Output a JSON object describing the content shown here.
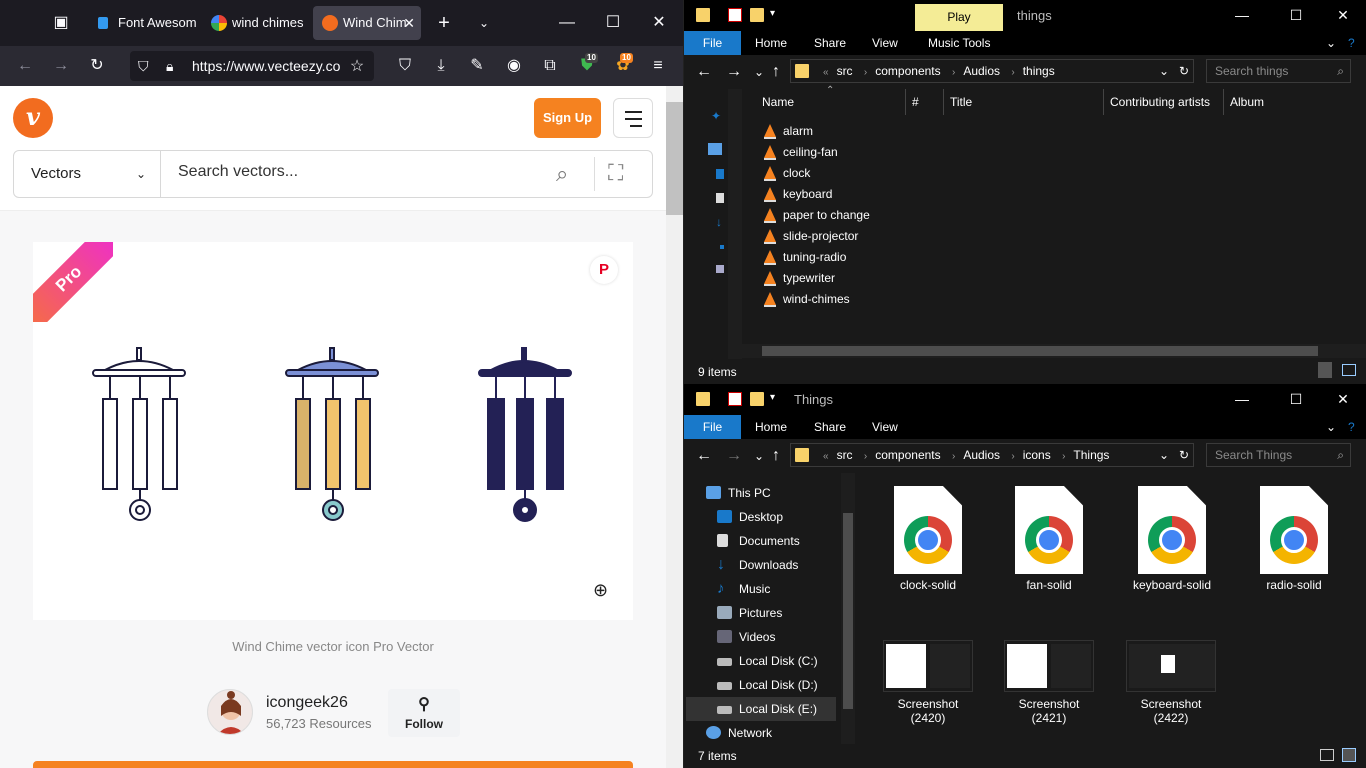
{
  "browser": {
    "tabs": [
      {
        "label": "Font Awesom",
        "active": false
      },
      {
        "label": "wind chimes",
        "active": false
      },
      {
        "label": "Wind Chim",
        "active": true
      }
    ],
    "url": "https://www.vecteezy.co",
    "badge1": "10",
    "badge2": "10"
  },
  "site": {
    "logo": "v",
    "signup": "Sign Up",
    "category": "Vectors",
    "search_placeholder": "Search vectors...",
    "pro_label": "Pro",
    "pin_icon": "P",
    "caption": "Wind Chime vector icon Pro Vector",
    "author": "icongeek26",
    "resources": "56,723 Resources",
    "follow": "Follow"
  },
  "explorer_top": {
    "play_tab": "Play",
    "title": "things",
    "ribbon": [
      "File",
      "Home",
      "Share",
      "View",
      "Music Tools"
    ],
    "path": [
      "src",
      "components",
      "Audios",
      "things"
    ],
    "search_placeholder": "Search things",
    "columns": [
      "Name",
      "#",
      "Title",
      "Contributing artists",
      "Album"
    ],
    "files": [
      "alarm",
      "ceiling-fan",
      "clock",
      "keyboard",
      "paper to change",
      "slide-projector",
      "tuning-radio",
      "typewriter",
      "wind-chimes"
    ],
    "status": "9 items"
  },
  "explorer_bottom": {
    "title": "Things",
    "ribbon": [
      "File",
      "Home",
      "Share",
      "View"
    ],
    "path": [
      "src",
      "components",
      "Audios",
      "icons",
      "Things"
    ],
    "search_placeholder": "Search Things",
    "tree": [
      "This PC",
      "Desktop",
      "Documents",
      "Downloads",
      "Music",
      "Pictures",
      "Videos",
      "Local Disk (C:)",
      "Local Disk (D:)",
      "Local Disk (E:)",
      "Network"
    ],
    "svg_files": [
      "clock-solid",
      "fan-solid",
      "keyboard-solid",
      "radio-solid"
    ],
    "screenshots": [
      {
        "name": "Screenshot",
        "num": "(2420)"
      },
      {
        "name": "Screenshot",
        "num": "(2421)"
      },
      {
        "name": "Screenshot",
        "num": "(2422)"
      }
    ],
    "status": "7 items"
  },
  "colors": {
    "accent": "#f58220",
    "ribbon_file": "#1979ca",
    "folder": "#f8d26a"
  }
}
